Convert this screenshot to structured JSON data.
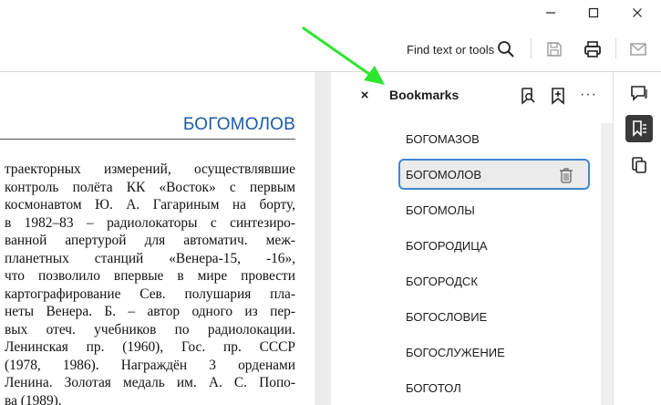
{
  "window": {
    "minimize_icon": "minimize-icon",
    "maximize_icon": "maximize-icon",
    "close_icon": "close-icon"
  },
  "toolbar": {
    "find_label": "Find text or tools",
    "icons": [
      "search-icon",
      "save-icon",
      "print-icon",
      "mail-icon"
    ]
  },
  "document": {
    "heading": "БОГОМОЛОВ",
    "lines": [
      "траекторных измерений, осуществлявшие",
      "контроль полёта КК «Восток» с первым",
      "космонавтом Ю. А. Гагариным на борту,",
      "в 1982–83 – радиолокаторы с синтезиро-",
      "ванной апертурой для автоматич. меж-",
      "планетных станций «Венера-15, -16»,",
      "что позволило впервые в мире провести",
      "картографирование Сев. полушария пла-",
      "неты Венера. Б. – автор одного из пер-",
      "вых отеч. учебников по радиолокации.",
      "Ленинская пр. (1960), Гос. пр. СССР",
      "(1978, 1986). Награждён 3 орденами",
      "Ленина. Золотая медаль им. А. С. Попо-",
      "ва (1989)."
    ]
  },
  "bookmarks": {
    "title": "Bookmarks",
    "close_glyph": "×",
    "more_glyph": "···",
    "items": [
      {
        "label": "БОГОМАЗОВ",
        "selected": false
      },
      {
        "label": "БОГОМОЛОВ",
        "selected": true
      },
      {
        "label": "БОГОМОЛЫ",
        "selected": false
      },
      {
        "label": "БОГОРОДИЦА",
        "selected": false
      },
      {
        "label": "БОГОРОДСК",
        "selected": false
      },
      {
        "label": "БОГОСЛОВИЕ",
        "selected": false
      },
      {
        "label": "БОГОСЛУЖЕНИЕ",
        "selected": false
      },
      {
        "label": "БОГОТОЛ",
        "selected": false
      }
    ]
  },
  "colors": {
    "accent": "#3f86d1",
    "heading": "#1b5aa6",
    "annotation_arrow": "#2ee62e"
  }
}
